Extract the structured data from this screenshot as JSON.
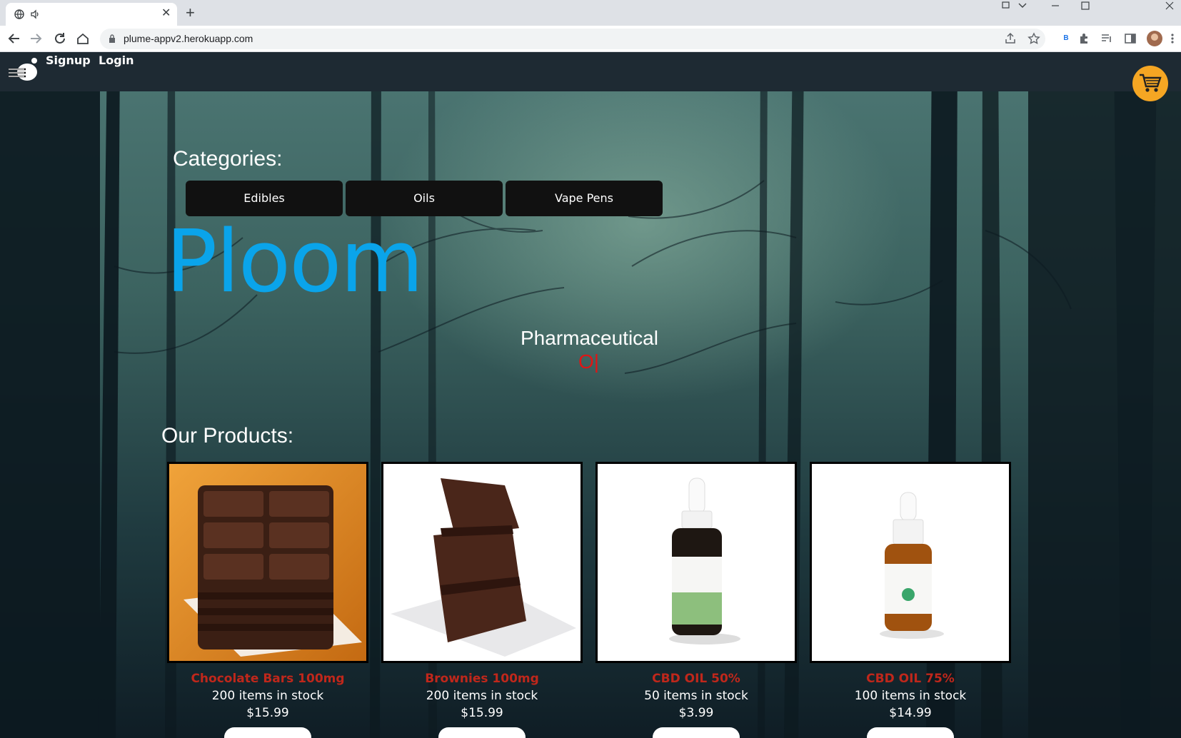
{
  "browser": {
    "tab_close": "✕",
    "new_tab": "+",
    "url": "plume-appv2.herokuapp.com",
    "profile_badge": "B"
  },
  "nav": {
    "signup": "Signup",
    "login": "Login"
  },
  "categories": {
    "title": "Categories:",
    "items": [
      "Edibles",
      "Oils",
      "Vape Pens"
    ]
  },
  "hero": {
    "brand": "Ploom",
    "tagline": "Pharmaceutical",
    "typed_text": "O|"
  },
  "products": {
    "title": "Our Products:",
    "items": [
      {
        "name": "Chocolate Bars 100mg",
        "stock": "200 items in stock",
        "price": "$15.99",
        "image": "chocolate-bar"
      },
      {
        "name": "Brownies 100mg",
        "stock": "200 items in stock",
        "price": "$15.99",
        "image": "brownies"
      },
      {
        "name": "CBD OIL 50%",
        "stock": "50 items in stock",
        "price": "$3.99",
        "image": "cbd-bottle-green"
      },
      {
        "name": "CBD OIL 75%",
        "stock": "100 items in stock",
        "price": "$14.99",
        "image": "cbd-bottle-amber"
      }
    ]
  },
  "colors": {
    "brand": "#0aa4ea",
    "product_name": "#c0271b",
    "cart": "#f5a623",
    "nav_bg": "#1e2a33"
  }
}
